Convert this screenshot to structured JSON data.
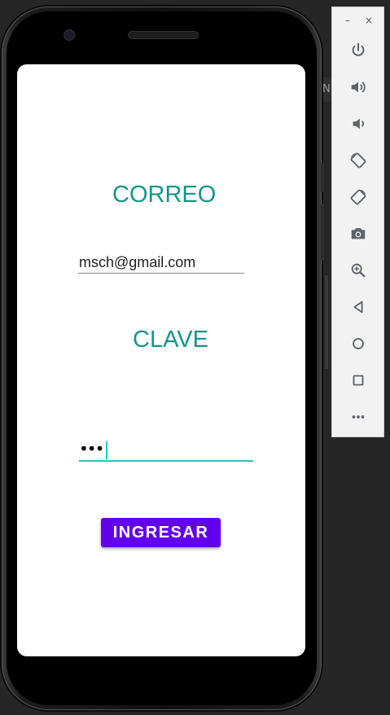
{
  "screen": {
    "correo_label": "CORREO",
    "email_value": "msch@gmail.com",
    "clave_label": "CLAVE",
    "password_masked": "•••",
    "ingresar_button": "INGRESAR"
  },
  "emulator_toolbar": {
    "window_controls": {
      "minimize": "–",
      "close": "×"
    },
    "buttons": [
      "power-icon",
      "volume-up-icon",
      "volume-down-icon",
      "rotate-left-icon",
      "rotate-right-icon",
      "camera-icon",
      "zoom-icon",
      "back-icon",
      "home-icon",
      "overview-icon",
      "more-icon"
    ]
  },
  "background_panel_fragment": "N",
  "colors": {
    "title_teal": "#149688",
    "primary_button": "#6200ee",
    "focus_underline": "#1ec9c0",
    "toolbar_icon": "#5f6368"
  }
}
